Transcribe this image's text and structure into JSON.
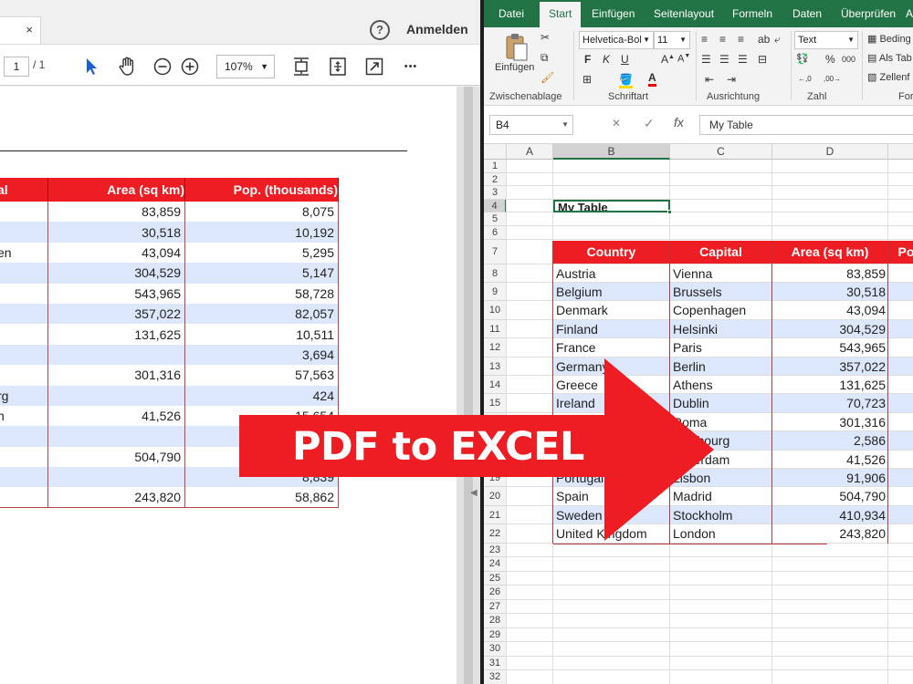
{
  "pdf": {
    "close_glyph": "×",
    "help_glyph": "?",
    "signin_label": "Anmelden",
    "page_current": "1",
    "page_total": "/ 1",
    "zoom_value": "107%",
    "more_glyph": "•••",
    "table": {
      "headers": [
        "al",
        "Area (sq km)",
        "Pop. (thousands)"
      ],
      "rows": [
        [
          "",
          "83,859",
          "8,075"
        ],
        [
          "",
          "30,518",
          "10,192"
        ],
        [
          "en",
          "43,094",
          "5,295"
        ],
        [
          "",
          "304,529",
          "5,147"
        ],
        [
          "",
          "543,965",
          "58,728"
        ],
        [
          "",
          "357,022",
          "82,057"
        ],
        [
          "",
          "131,625",
          "10,511"
        ],
        [
          "",
          "",
          "3,694"
        ],
        [
          "",
          "301,316",
          "57,563"
        ],
        [
          "rg",
          "",
          "424"
        ],
        [
          "n",
          "41,526",
          "15,654"
        ],
        [
          "",
          "",
          ""
        ],
        [
          "",
          "504,790",
          ""
        ],
        [
          "",
          "",
          "8,839"
        ],
        [
          "",
          "243,820",
          "58,862"
        ]
      ]
    }
  },
  "excel": {
    "tabs": [
      "Datei",
      "Start",
      "Einfügen",
      "Seitenlayout",
      "Formeln",
      "Daten",
      "Überprüfen",
      "A"
    ],
    "active_tab": "Start",
    "groups": {
      "clipboard": "Zwischenablage",
      "font": "Schriftart",
      "alignment": "Ausrichtung",
      "number": "Zahl",
      "styles": "For"
    },
    "paste_label": "Einfügen",
    "font_name": "Helvetica-Bol",
    "font_size": "11",
    "number_format": "Text",
    "styles_items": [
      "Beding",
      "Als Tab",
      "Zellenf"
    ],
    "bold": "F",
    "italic": "K",
    "underline": "U",
    "namebox": "B4",
    "fx": "fx",
    "cancel_glyph": "✕",
    "enter_glyph": "✓",
    "formula": "My Table",
    "columns": [
      "A",
      "B",
      "C",
      "D"
    ],
    "rows": [
      "1",
      "2",
      "3",
      "4",
      "5",
      "6",
      "7",
      "8",
      "9",
      "10",
      "11",
      "12",
      "13",
      "14",
      "15",
      "16",
      "17",
      "18",
      "19",
      "20",
      "21",
      "22",
      "23",
      "24",
      "25",
      "26",
      "27",
      "28",
      "29",
      "30",
      "31",
      "32"
    ],
    "title_cell": "My Table",
    "table_headers": [
      "Country",
      "Capital",
      "Area (sq km)",
      "Po"
    ],
    "table_rows": [
      [
        "Austria",
        "Vienna",
        "83,859"
      ],
      [
        "Belgium",
        "Brussels",
        "30,518"
      ],
      [
        "Denmark",
        "Copenhagen",
        "43,094"
      ],
      [
        "Finland",
        "Helsinki",
        "304,529"
      ],
      [
        "France",
        "Paris",
        "543,965"
      ],
      [
        "Germany",
        "Berlin",
        "357,022"
      ],
      [
        "Greece",
        "Athens",
        "131,625"
      ],
      [
        "Ireland",
        "Dublin",
        "70,723"
      ],
      [
        "",
        "Roma",
        "301,316"
      ],
      [
        "",
        "xembourg",
        "2,586"
      ],
      [
        "",
        "msterdam",
        "41,526"
      ],
      [
        "Portugal",
        "Lisbon",
        "91,906"
      ],
      [
        "Spain",
        "Madrid",
        "504,790"
      ],
      [
        "Sweden",
        "Stockholm",
        "410,934"
      ],
      [
        "United Kingdom",
        "London",
        "243,820"
      ]
    ]
  },
  "banner": {
    "label": "PDF to EXCEL",
    "color": "#ee1c23"
  }
}
